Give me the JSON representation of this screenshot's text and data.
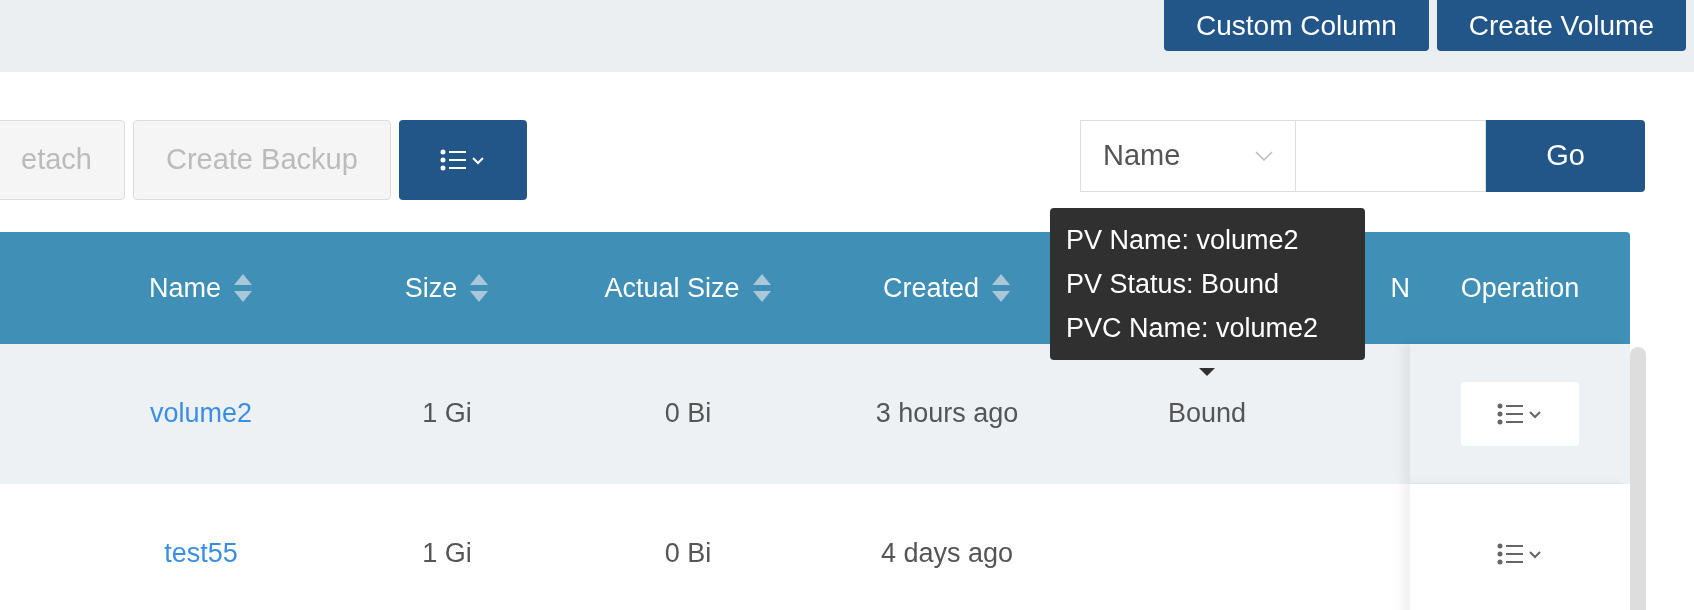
{
  "header_buttons": [
    "Custom Column",
    "Create Volume"
  ],
  "toolbar": {
    "buttons": [
      {
        "label": "etach",
        "disabled": true
      },
      {
        "label": "Create Backup",
        "disabled": true
      }
    ]
  },
  "search": {
    "field": "Name",
    "button": "Go"
  },
  "table": {
    "columns": [
      {
        "label": "Name",
        "sortable": true
      },
      {
        "label": "Size",
        "sortable": true
      },
      {
        "label": "Actual Size",
        "sortable": true
      },
      {
        "label": "Created",
        "sortable": true
      },
      {
        "label": "N",
        "sortable": false
      },
      {
        "label": "Operation",
        "sortable": false
      }
    ],
    "rows": [
      {
        "name": "volume2",
        "size": "1 Gi",
        "actual_size": "0 Bi",
        "created": "3 hours ago",
        "pv_pvc": "Bound",
        "highlighted": true
      },
      {
        "name": "test55",
        "size": "1 Gi",
        "actual_size": "0 Bi",
        "created": "4 days ago",
        "highlighted": false
      }
    ]
  },
  "tooltip": {
    "lines": [
      "PV Name: volume2",
      "PV Status: Bound",
      "PVC Name: volume2"
    ]
  }
}
